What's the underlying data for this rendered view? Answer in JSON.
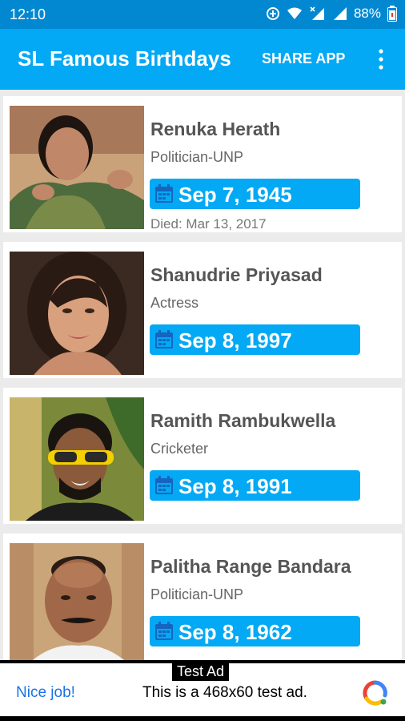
{
  "status_bar": {
    "time": "12:10",
    "battery": "88%",
    "icons": [
      "data-saver-icon",
      "wifi-icon",
      "signal-x-icon",
      "signal-icon",
      "battery-icon"
    ]
  },
  "app_bar": {
    "title": "SL Famous Birthdays",
    "share_label": "SHARE APP",
    "overflow_icon": "more-vert-icon",
    "color": "#03a9f4"
  },
  "people": [
    {
      "name": "Renuka Herath",
      "role": "Politician-UNP",
      "birth_date": "Sep 7, 1945",
      "died": "Died: Mar 13, 2017"
    },
    {
      "name": "Shanudrie Priyasad",
      "role": "Actress",
      "birth_date": "Sep 8, 1997"
    },
    {
      "name": "Ramith Rambukwella",
      "role": "Cricketer",
      "birth_date": "Sep 8, 1991"
    },
    {
      "name": "Palitha Range Bandara",
      "role": "Politician-UNP",
      "birth_date": "Sep 8, 1962"
    }
  ],
  "ad": {
    "tag": "Test Ad",
    "cta": "Nice job!",
    "text": "This is a 468x60 test ad."
  }
}
